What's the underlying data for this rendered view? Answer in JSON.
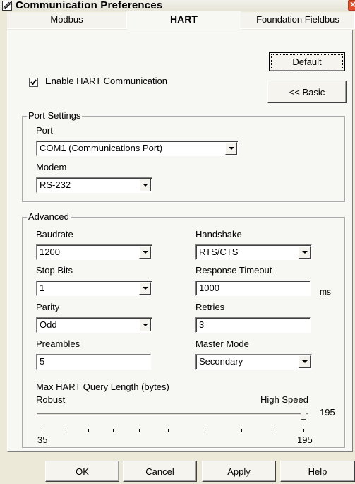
{
  "window": {
    "title": "Communication Preferences"
  },
  "tabs": [
    "Modbus",
    "HART",
    "Foundation Fieldbus"
  ],
  "active_tab": "HART",
  "buttons": {
    "default": "Default",
    "basic": "<< Basic"
  },
  "enable_hart": {
    "label": "Enable HART Communication",
    "checked": true
  },
  "port_settings": {
    "title": "Port Settings",
    "port_label": "Port",
    "port_value": "COM1 (Communications Port)",
    "modem_label": "Modem",
    "modem_value": "RS-232"
  },
  "advanced": {
    "title": "Advanced",
    "baudrate_label": "Baudrate",
    "baudrate_value": "1200",
    "handshake_label": "Handshake",
    "handshake_value": "RTS/CTS",
    "stopbits_label": "Stop Bits",
    "stopbits_value": "1",
    "timeout_label": "Response Timeout",
    "timeout_value": "1000",
    "timeout_unit": "ms",
    "parity_label": "Parity",
    "parity_value": "Odd",
    "retries_label": "Retries",
    "retries_value": "3",
    "preambles_label": "Preambles",
    "preambles_value": "5",
    "mastermode_label": "Master Mode",
    "mastermode_value": "Secondary"
  },
  "query_length": {
    "label": "Max HART Query Length (bytes)",
    "left_label": "Robust",
    "right_label": "High Speed",
    "current_value": "195",
    "min_label": "35",
    "max_label": "195",
    "value": 195,
    "min": 35,
    "max": 195
  },
  "footer": {
    "ok": "OK",
    "cancel": "Cancel",
    "apply": "Apply",
    "help": "Help"
  }
}
